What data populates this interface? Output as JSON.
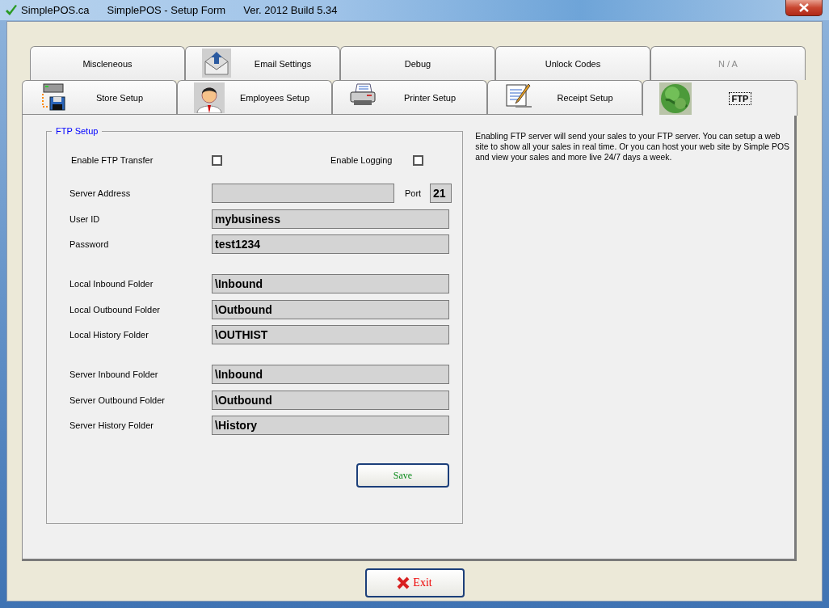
{
  "window": {
    "app": "SimplePOS.ca",
    "title": "SimplePOS - Setup Form",
    "version": "Ver. 2012 Build 5.34"
  },
  "tab_rows": [
    {
      "tabs": [
        {
          "label": "Miscleneous",
          "kind": "text",
          "selected": false,
          "disabled": false
        },
        {
          "label": "Email Settings",
          "kind": "email",
          "selected": false,
          "disabled": false
        },
        {
          "label": "Debug",
          "kind": "text",
          "selected": false,
          "disabled": false
        },
        {
          "label": "Unlock Codes",
          "kind": "text",
          "selected": false,
          "disabled": false
        },
        {
          "label": "N / A",
          "kind": "text",
          "selected": false,
          "disabled": true
        }
      ]
    },
    {
      "tabs": [
        {
          "label": "Store Setup",
          "kind": "store",
          "selected": false,
          "disabled": false
        },
        {
          "label": "Employees Setup",
          "kind": "employee",
          "selected": false,
          "disabled": false
        },
        {
          "label": "Printer Setup",
          "kind": "printer",
          "selected": false,
          "disabled": false
        },
        {
          "label": "Receipt Setup",
          "kind": "receipt",
          "selected": false,
          "disabled": false
        },
        {
          "label": "FTP",
          "kind": "ftp",
          "selected": true,
          "disabled": false
        }
      ]
    }
  ],
  "group_title": "FTP Setup",
  "checkboxes": [
    {
      "label": "Enable FTP Transfer",
      "checked": false
    },
    {
      "label": "Enable Logging",
      "checked": false
    }
  ],
  "field_groups": [
    [
      {
        "label": "Server Address",
        "port_label": "Port",
        "port_value": "21"
      },
      {
        "label": "User ID",
        "value": "mybusiness"
      },
      {
        "label": "Password",
        "value": "test1234"
      }
    ],
    [
      {
        "label": "Local Inbound Folder",
        "value": "\\Inbound"
      },
      {
        "label": "Local Outbound Folder",
        "value": "\\Outbound"
      },
      {
        "label": "Local History Folder",
        "value": "\\OUTHIST"
      }
    ],
    [
      {
        "label": "Server Inbound Folder",
        "value": "\\Inbound"
      },
      {
        "label": "Server Outbound Folder",
        "value": "\\Outbound"
      },
      {
        "label": "Server History Folder",
        "value": "\\History"
      }
    ]
  ],
  "save_button": "Save",
  "description": "Enabling FTP server will send your sales to your FTP server. You can setup a web site to show all your sales in real time. Or you can host your web site by Simple POS and view your sales and more live 24/7 days a week.",
  "exit_button": "Exit"
}
